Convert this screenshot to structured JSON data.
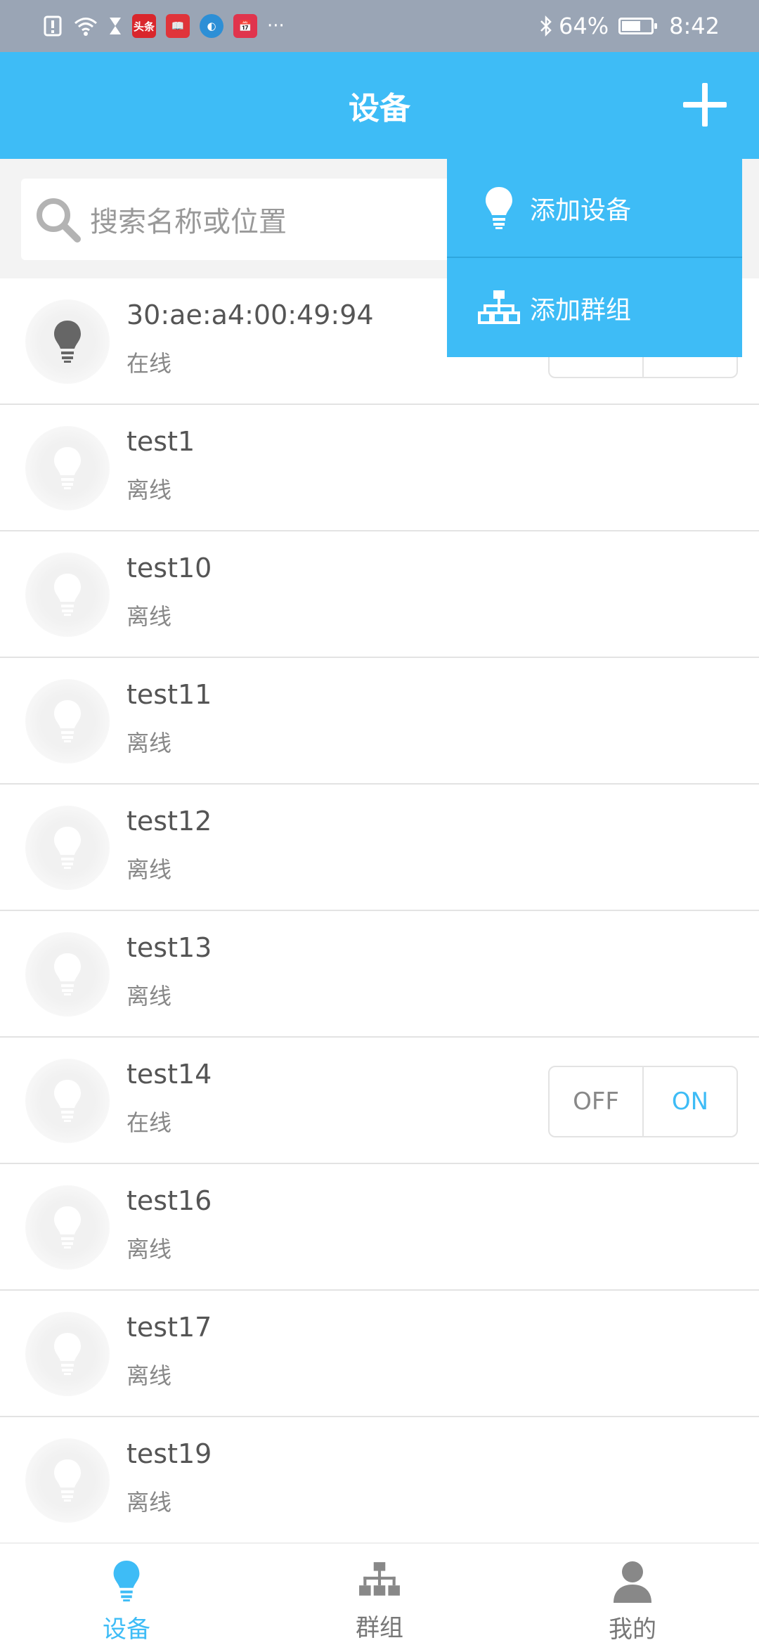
{
  "status_bar": {
    "app_icons": [
      "头条",
      "📖",
      "◐",
      "📅"
    ],
    "more": "···",
    "battery": "64%",
    "battery_level": 0.64,
    "time": "8:42"
  },
  "header": {
    "title": "设备"
  },
  "search": {
    "placeholder": "搜索名称或位置"
  },
  "menu": {
    "add_device": "添加设备",
    "add_group": "添加群组"
  },
  "devices": [
    {
      "name": "30:ae:a4:00:49:94",
      "status": "在线",
      "online": true
    },
    {
      "name": "test1",
      "status": "离线",
      "online": false
    },
    {
      "name": "test10",
      "status": "离线",
      "online": false
    },
    {
      "name": "test11",
      "status": "离线",
      "online": false
    },
    {
      "name": "test12",
      "status": "离线",
      "online": false
    },
    {
      "name": "test13",
      "status": "离线",
      "online": false
    },
    {
      "name": "test14",
      "status": "在线",
      "online": true,
      "toggle": {
        "off": "OFF",
        "on": "ON"
      }
    },
    {
      "name": "test16",
      "status": "离线",
      "online": false
    },
    {
      "name": "test17",
      "status": "离线",
      "online": false
    },
    {
      "name": "test19",
      "status": "离线",
      "online": false
    }
  ],
  "nav": {
    "devices": "设备",
    "groups": "群组",
    "me": "我的"
  },
  "colors": {
    "accent": "#3ebcf6",
    "status_bar": "#9aa5b5"
  }
}
